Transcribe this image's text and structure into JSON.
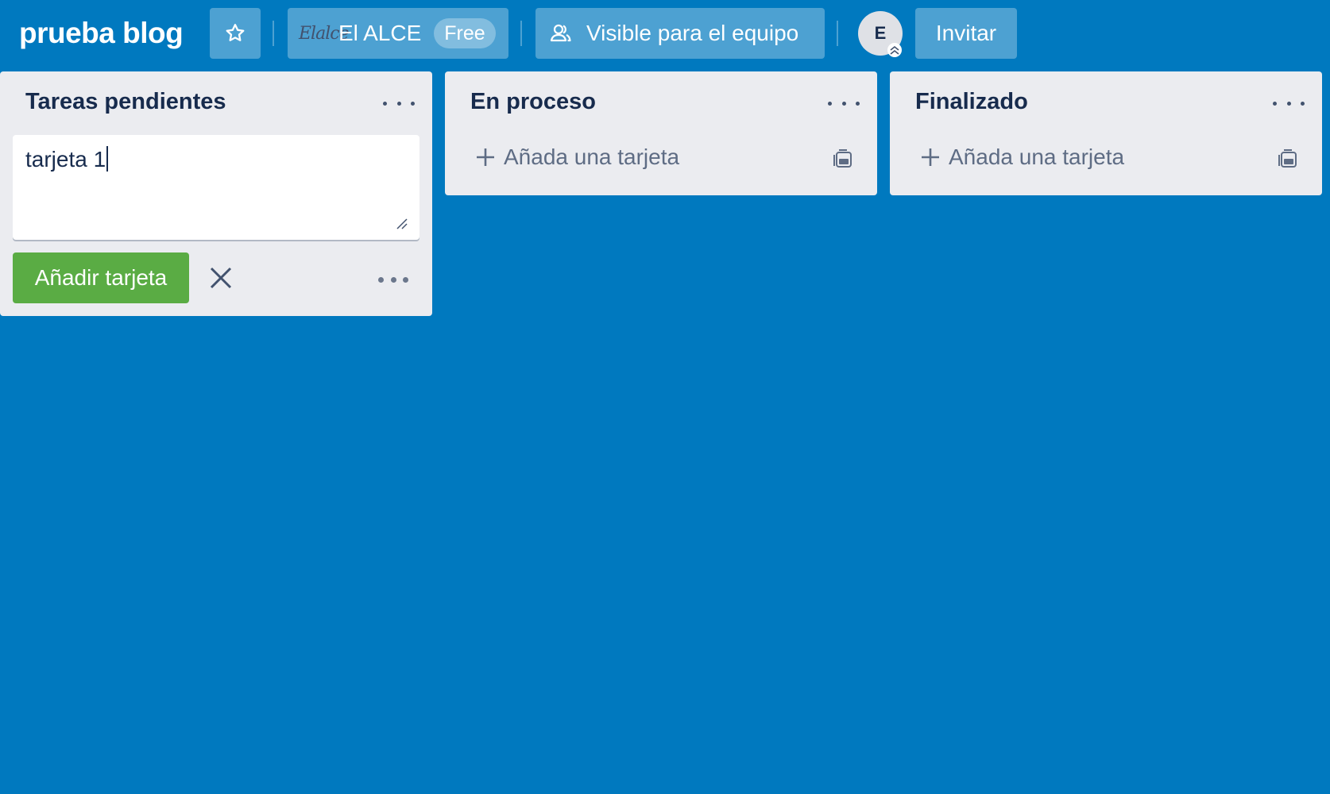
{
  "board": {
    "title": "prueba blog"
  },
  "header": {
    "star_icon": "star-outline-icon",
    "team_logo_text": "Elalce",
    "team_name": "El ALCE",
    "team_badge": "Free",
    "visibility_icon": "team-people-icon",
    "visibility_label": "Visible para el equipo",
    "avatar_initial": "E",
    "invite_label": "Invitar"
  },
  "lists": [
    {
      "title": "Tareas pendientes",
      "composer": {
        "text": "tarjeta 1",
        "add_label": "Añadir tarjeta"
      }
    },
    {
      "title": "En proceso",
      "add_card_label": "Añada una tarjeta"
    },
    {
      "title": "Finalizado",
      "add_card_label": "Añada una tarjeta"
    }
  ],
  "colors": {
    "board_background": "#0079bf",
    "list_background": "#ebecf0",
    "add_button": "#5aac44",
    "text_dark": "#172b4d",
    "text_muted": "#5e6c84"
  }
}
